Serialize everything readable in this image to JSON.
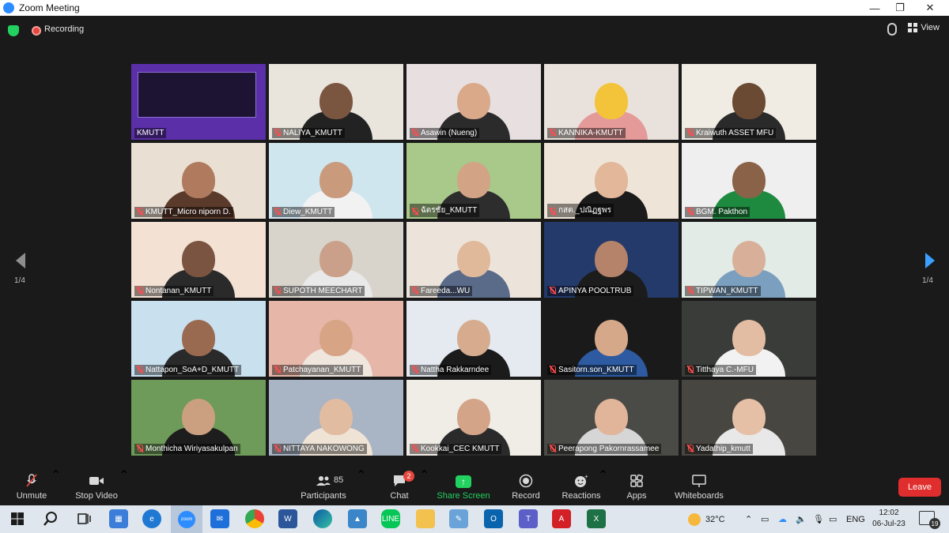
{
  "window": {
    "title": "Zoom Meeting",
    "minimize": "—",
    "maximize": "❐",
    "close": "✕"
  },
  "topbar": {
    "recording_label": "Recording",
    "view_label": "View"
  },
  "gallery": {
    "page_left": "1/4",
    "page_right": "1/4",
    "participants": [
      {
        "name": "KMUTT",
        "muted": false,
        "active": true,
        "bg": "#5a2fa8",
        "skin": "#222",
        "shirt": "#222"
      },
      {
        "name": "NALIYA_KMUTT",
        "muted": true,
        "bg": "#e9e4dc",
        "skin": "#7a5540",
        "shirt": "#222"
      },
      {
        "name": "Asawin (Nueng)",
        "muted": true,
        "bg": "#e8dfe0",
        "skin": "#d9a989",
        "shirt": "#2b2b2b"
      },
      {
        "name": "KANNIKA-KMUTT",
        "muted": true,
        "bg": "#e9e2dc",
        "skin": "#f3c43a",
        "shirt": "#e59a9a"
      },
      {
        "name": "Kraiwuth ASSET MFU",
        "muted": true,
        "bg": "#f0ece4",
        "skin": "#6b4a34",
        "shirt": "#2a2a2a"
      },
      {
        "name": "KMUTT_Micro niporn D.",
        "muted": true,
        "bg": "#e9dfd2",
        "skin": "#b07a5e",
        "shirt": "#5a3a2a"
      },
      {
        "name": "Diew_KMUTT",
        "muted": true,
        "bg": "#cfe6ef",
        "skin": "#c99a7c",
        "shirt": "#f2f2f2"
      },
      {
        "name": "ฉัตรชัย_KMUTT",
        "muted": true,
        "bg": "#a8c98a",
        "skin": "#d3a386",
        "shirt": "#2d2d2d"
      },
      {
        "name": "กสต._ปณิฏฐพร",
        "muted": true,
        "bg": "#efe4d8",
        "skin": "#e2b79a",
        "shirt": "#1b1b1b"
      },
      {
        "name": "BGM. Pakthon",
        "muted": true,
        "bg": "#efefef",
        "skin": "#8a6248",
        "shirt": "#1e8a3f"
      },
      {
        "name": "Nontanan_KMUTT",
        "muted": true,
        "bg": "#f3e1d3",
        "skin": "#7a5440",
        "shirt": "#2a2a2a"
      },
      {
        "name": "SUPOTH MEECHART",
        "muted": true,
        "bg": "#d8d4cc",
        "skin": "#caa08a",
        "shirt": "#e9e9e9"
      },
      {
        "name": "Fareeda...WU",
        "muted": true,
        "bg": "#ece4da",
        "skin": "#e0b89a",
        "shirt": "#5a6b8a"
      },
      {
        "name": "APINYA POOLTRUB",
        "muted": true,
        "bg": "#243a6a",
        "skin": "#b5826a",
        "shirt": "#1c1c1c"
      },
      {
        "name": "TIPWAN_KMUTT",
        "muted": true,
        "bg": "#e3ebe6",
        "skin": "#d8b09a",
        "shirt": "#7a9fbf"
      },
      {
        "name": "Nattapon_SoA+D_KMUTT",
        "muted": true,
        "bg": "#c9e0ef",
        "skin": "#9a6a50",
        "shirt": "#2a2a2a"
      },
      {
        "name": "Patchayanan_KMUTT",
        "muted": true,
        "bg": "#e6b7a9",
        "skin": "#d7a585",
        "shirt": "#efe6de"
      },
      {
        "name": "Nattha Rakkarndee",
        "muted": true,
        "bg": "#e4eaf0",
        "skin": "#d7ac8e",
        "shirt": "#1b1b1b"
      },
      {
        "name": "Sasitorn.son_KMUTT",
        "muted": true,
        "bg": "#1a1a1a",
        "skin": "#d5a88a",
        "shirt": "#2d5aa0"
      },
      {
        "name": "Titthaya C.-MFU",
        "muted": true,
        "bg": "#3a3c3a",
        "skin": "#e3bda3",
        "shirt": "#f2f2f2"
      },
      {
        "name": "Monthicha Wiriyasakulpan",
        "muted": true,
        "bg": "#6e9a5a",
        "skin": "#caa080",
        "shirt": "#1d1d1d"
      },
      {
        "name": "NITTAYA NAKOWONG",
        "muted": true,
        "bg": "#a9b4c4",
        "skin": "#e2bca0",
        "shirt": "#efe3d6"
      },
      {
        "name": "Kookkai_CEC KMUTT",
        "muted": true,
        "bg": "#f0ece6",
        "skin": "#d3a488",
        "shirt": "#2a2a2a"
      },
      {
        "name": "Peerapong Pakornrassamee",
        "muted": true,
        "bg": "#4a4a46",
        "skin": "#e1b599",
        "shirt": "#d6d6d6"
      },
      {
        "name": "Yadathip_kmutt",
        "muted": true,
        "bg": "#484640",
        "skin": "#e5c0a6",
        "shirt": "#e8e8e8"
      }
    ]
  },
  "toolbar": {
    "unmute": "Unmute",
    "stop_video": "Stop Video",
    "participants": "Participants",
    "participants_count": "85",
    "chat": "Chat",
    "chat_badge": "2",
    "share_screen": "Share Screen",
    "record": "Record",
    "reactions": "Reactions",
    "apps": "Apps",
    "whiteboards": "Whiteboards",
    "leave": "Leave"
  },
  "taskbar": {
    "temperature": "32°C",
    "language": "ENG",
    "time": "12:02",
    "date": "06-Jul-23",
    "notifications": "19",
    "zoom_app": "zoom"
  }
}
